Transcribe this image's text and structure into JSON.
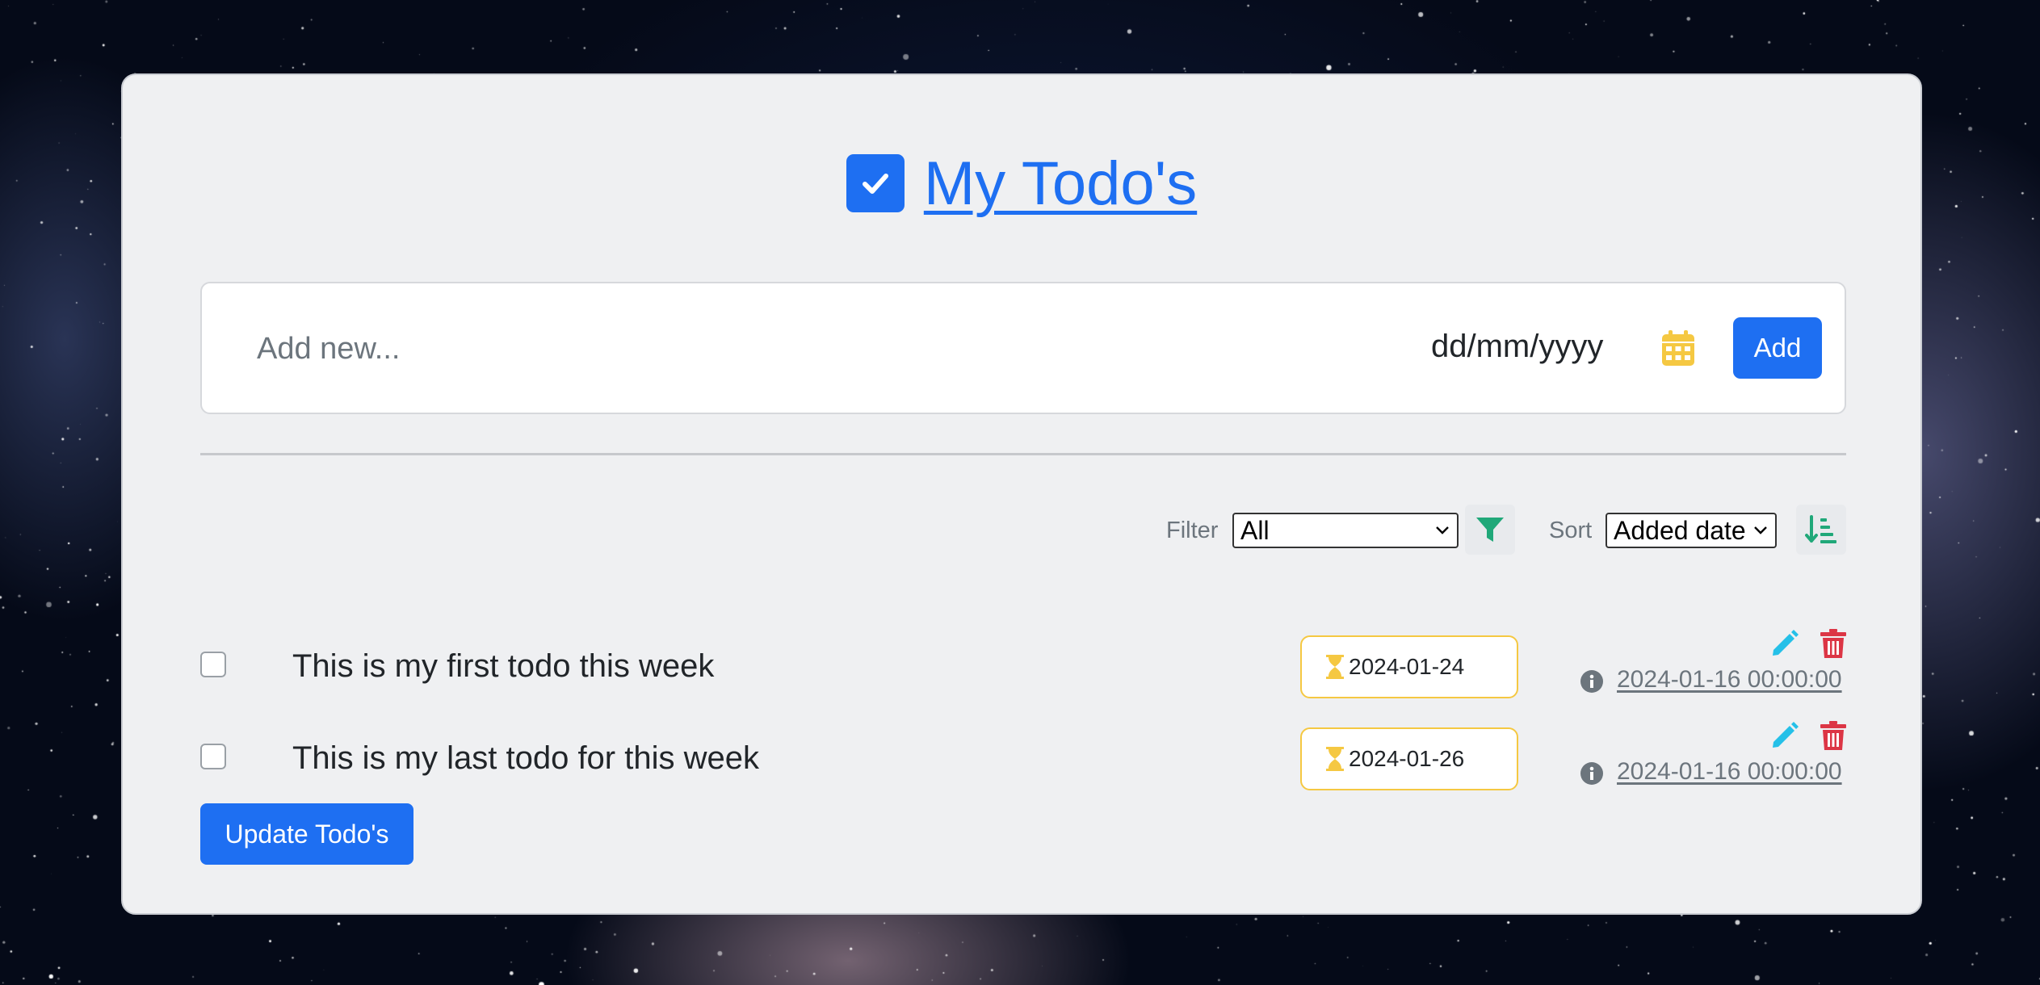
{
  "header": {
    "title": "My Todo's",
    "title_icon": "check-square-icon"
  },
  "add_form": {
    "input_placeholder": "Add new...",
    "date_placeholder": "dd/mm/yyyy",
    "calendar_icon": "calendar-icon",
    "add_label": "Add"
  },
  "filters": {
    "filter_label": "Filter",
    "filter_value": "All",
    "filter_icon": "filter-icon",
    "sort_label": "Sort",
    "sort_value": "Added date",
    "sort_icon": "sort-ascending-icon"
  },
  "todos": [
    {
      "text": "This is my first todo this week",
      "due": "2024-01-24",
      "created": "2024-01-16 00:00:00",
      "done": false
    },
    {
      "text": "This is my last todo for this week",
      "due": "2024-01-26",
      "created": "2024-01-16 00:00:00",
      "done": false
    }
  ],
  "footer": {
    "update_label": "Update Todo's"
  },
  "colors": {
    "primary": "#1e6ff2",
    "warning": "#f5c842",
    "success": "#20a879",
    "info": "#25c0e8",
    "danger": "#dc3545",
    "muted": "#6c757d"
  }
}
